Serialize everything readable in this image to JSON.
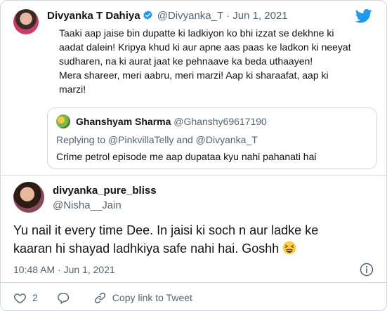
{
  "quoted_tweet": {
    "author_name": "Divyanka T Dahiya",
    "author_handle": "@Divyanka_T",
    "separator": "·",
    "date": "Jun 1, 2021",
    "lines": [
      "Taaki aap jaise bin dupatte ki ladkiyon ko bhi izzat se dekhne ki",
      "aadat dalein! Kripya khud ki aur apne aas paas ke ladkon ki neeyat",
      "sudharen, na ki aurat jaat ke pehnaave ka beda uthaayen!",
      "Mera shareer, meri aabru, meri marzi! Aap ki sharaafat, aap ki",
      "marzi!"
    ]
  },
  "nested_quote": {
    "author_name": "Ghanshyam Sharma",
    "author_handle": "@Ghanshy69617190",
    "replying_prefix": "Replying to",
    "reply_mention_1": "@PinkvillaTelly",
    "reply_conjunction": "and",
    "reply_mention_2": "@Divyanka_T",
    "text": "Crime petrol episode me aap dupataa kyu nahi pahanati hai"
  },
  "main_tweet": {
    "author_name": "divyanka_pure_bliss",
    "author_handle": "@Nisha__Jain",
    "text_line_1": "Yu nail it every time Dee. In jaisi ki soch n aur ladke ke",
    "text_line_2": "kaaran hi shayad ladhkiya safe nahi hai. Goshh",
    "time": "10:48 AM",
    "separator": "·",
    "date": "Jun 1, 2021",
    "like_count": "2",
    "copy_link_label": "Copy link to Tweet"
  },
  "icons": {
    "verified": "verified-badge-icon",
    "twitter": "twitter-bird-icon",
    "emoji": "tired-face-emoji",
    "info": "info-icon",
    "like": "heart-icon",
    "reply": "reply-bubble-icon",
    "link": "link-icon"
  },
  "colors": {
    "brand_blue": "#1d9bf0",
    "text_primary": "#0f1419",
    "text_secondary": "#536471",
    "border": "#cfd9de"
  }
}
